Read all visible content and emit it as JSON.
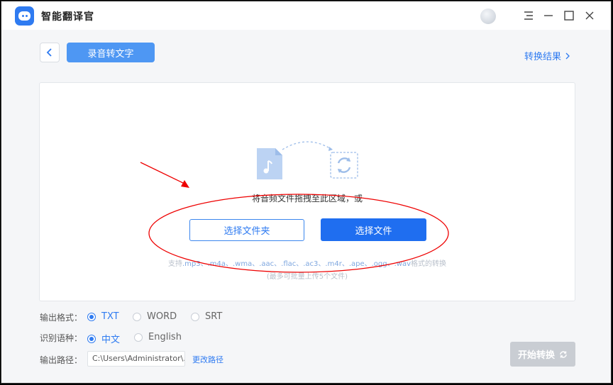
{
  "app": {
    "title": "智能翻译官",
    "accent": "#2f7bf1"
  },
  "toolbar": {
    "mode_tab": "录音转文字",
    "results_link": "转换结果"
  },
  "dropzone": {
    "hint": "将音频文件拖拽至此区域，或",
    "select_folder": "选择文件夹",
    "select_file": "选择文件",
    "formats_prefix": "支持",
    "formats": ".mp3、.m4a、.wma、.aac、.flac、.ac3、.m4r、.ape、.ogg、.wav",
    "formats_suffix": "格式的转换",
    "limit": "(最多可批量上传5个文件)"
  },
  "settings": {
    "output_format": {
      "label": "输出格式：",
      "options": [
        "TXT",
        "WORD",
        "SRT"
      ],
      "selected": "TXT"
    },
    "language": {
      "label": "识别语种：",
      "options": [
        "中文",
        "English"
      ],
      "selected": "中文"
    },
    "output_path": {
      "label": "输出路径：",
      "value": "C:\\Users\\Administrator\\...",
      "change_label": "更改路径"
    }
  },
  "start_button": {
    "label": "开始转换"
  },
  "icons": [
    "app-logo-icon",
    "avatar",
    "menu-icon",
    "minimize-icon",
    "maximize-icon",
    "close-icon",
    "back-chevron-icon",
    "chevron-right-icon",
    "audio-file-icon",
    "convert-icon",
    "refresh-icon"
  ]
}
